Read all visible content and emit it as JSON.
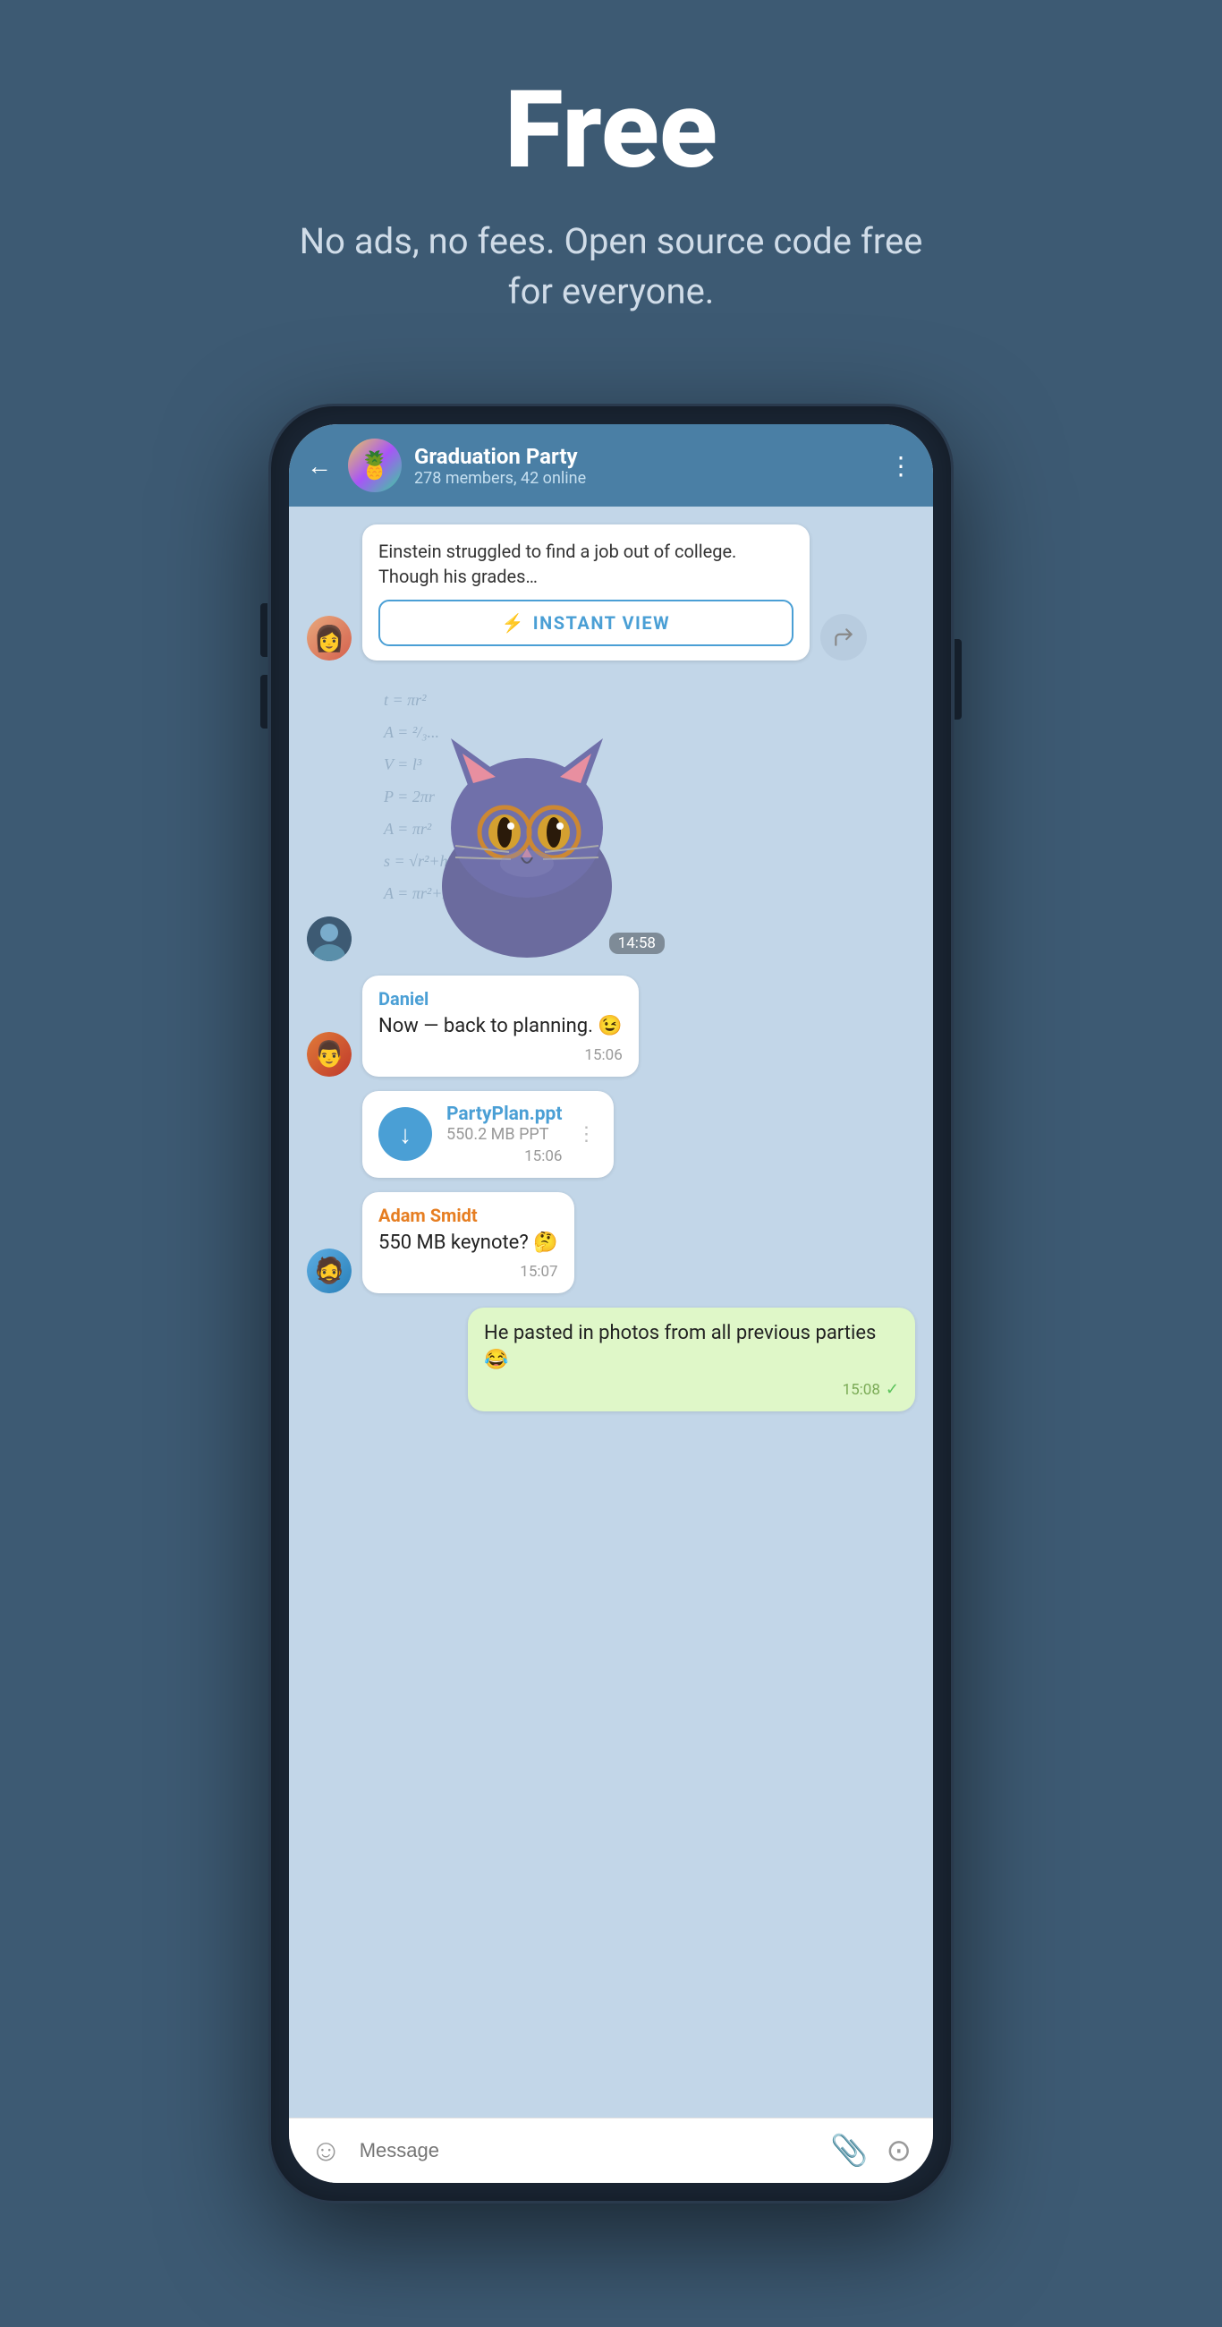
{
  "hero": {
    "title": "Free",
    "subtitle": "No ads, no fees. Open source code free for everyone."
  },
  "chat": {
    "back_label": "←",
    "group_name": "Graduation Party",
    "group_status": "278 members, 42 online",
    "menu_icon": "⋮",
    "group_emoji": "🍍"
  },
  "messages": {
    "link_preview_text": "Einstein struggled to find a job out of college. Though his grades…",
    "instant_view_label": "INSTANT VIEW",
    "instant_view_icon": "⚡",
    "sticker_time": "14:58",
    "msg1": {
      "sender": "Daniel",
      "text": "Now — back to planning. 😉",
      "time": "15:06"
    },
    "msg2": {
      "filename": "PartyPlan.ppt",
      "filemeta": "550.2 MB  PPT",
      "time": "15:06"
    },
    "msg3": {
      "sender": "Adam Smidt",
      "text": "550 MB keynote? 🤔",
      "time": "15:07"
    },
    "msg4": {
      "text": "He pasted in photos from all previous parties 😂",
      "time": "15:08"
    }
  },
  "input": {
    "placeholder": "Message",
    "emoji_icon": "☺",
    "attach_icon": "📎",
    "camera_icon": "⊙"
  },
  "colors": {
    "header_bg": "#4a7fa5",
    "chat_bg": "#c2d6e8",
    "body_bg": "#3d5a73",
    "own_bubble": "#dff7c8",
    "white_bubble": "#ffffff",
    "accent": "#4a9fd5"
  }
}
